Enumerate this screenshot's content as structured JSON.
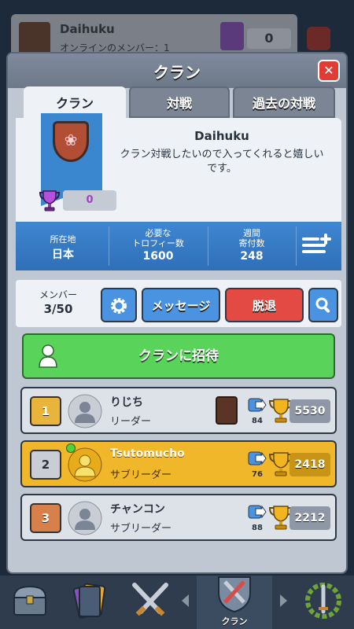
{
  "background": {
    "clan_name": "Daihuku",
    "online_text": "オンラインのメンバー：1",
    "trophy_count": "0"
  },
  "dialog": {
    "title": "クラン",
    "close_label": "✕"
  },
  "tabs": [
    {
      "label": "クラン",
      "active": true
    },
    {
      "label": "対戦",
      "active": false
    },
    {
      "label": "過去の対戦",
      "active": false
    }
  ],
  "clan": {
    "name": "Daihuku",
    "description": "クラン対戦したいので入ってくれると嬉しいです。",
    "trophies": "0",
    "flower_icon": "❀"
  },
  "stats": {
    "location_label": "所在地",
    "location_value": "日本",
    "required_label_1": "必要な",
    "required_label_2": "トロフィー数",
    "required_value": "1600",
    "weekly_label_1": "週間",
    "weekly_label_2": "寄付数",
    "weekly_value": "248"
  },
  "members_bar": {
    "label": "メンバー",
    "count": "3/50",
    "message_label": "メッセージ",
    "leave_label": "脱退"
  },
  "invite": {
    "label": "クランに招待"
  },
  "members": [
    {
      "rank": "1",
      "name": "りじち",
      "role": "リーダー",
      "donations": "84",
      "trophies": "5530",
      "highlight": false
    },
    {
      "rank": "2",
      "name": "Tsutomucho",
      "role": "サブリーダー",
      "donations": "76",
      "trophies": "2418",
      "highlight": true
    },
    {
      "rank": "3",
      "name": "チャンコン",
      "role": "サブリーダー",
      "donations": "88",
      "trophies": "2212",
      "highlight": false
    }
  ],
  "bottom_nav": {
    "clan_label": "クラン"
  },
  "colors": {
    "accent_blue": "#3f86d1",
    "invite_green": "#59d35a",
    "leave_red": "#e34a43",
    "self_row_gold": "#f0b72a",
    "trophy_purple": "#a23fc7"
  }
}
